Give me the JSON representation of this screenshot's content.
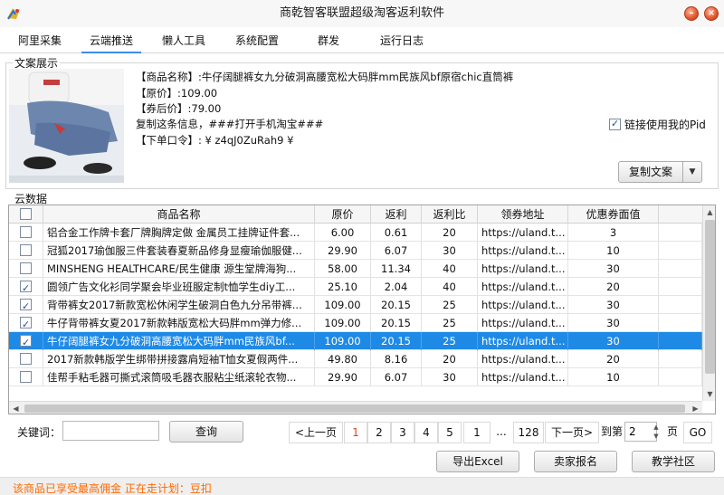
{
  "window": {
    "title": "商乾智客联盟超级淘客返利软件",
    "min_glyph": "–",
    "close_glyph": "×",
    "accent": "#1f8ae6",
    "logo_icon": "app-logo-icon"
  },
  "tabs": [
    {
      "label": "阿里采集"
    },
    {
      "label": "云端推送"
    },
    {
      "label": "懒人工具"
    },
    {
      "label": "系统配置"
    },
    {
      "label": "群发"
    },
    {
      "label": "运行日志"
    }
  ],
  "copy_panel": {
    "title": "文案展示",
    "lines": [
      "【商品名称】:牛仔阔腿裤女九分破洞高腰宽松大码胖mm民族风bf原宿chic直筒裤",
      "【原价】:109.00",
      "【券后价】:79.00",
      "复制这条信息，###打开手机淘宝###",
      "【下单口令】: ¥ z4qJ0ZuRah9 ¥"
    ],
    "use_my_pid_label": "链接使用我的Pid",
    "use_my_pid_checked": true,
    "copy_button": "复制文案",
    "dropdown_glyph": "▼"
  },
  "cloud_data": {
    "title": "云数据",
    "columns": [
      "商品名称",
      "原价",
      "返利",
      "返利比",
      "领券地址",
      "优惠券面值"
    ],
    "rows": [
      {
        "checked": false,
        "name": "铝合金工作牌卡套厂牌胸牌定做 金属员工挂牌证件套...",
        "price": "6.00",
        "rebate": "0.61",
        "ratio": "20",
        "url": "https://uland.t...",
        "coupon": "3",
        "selected": false
      },
      {
        "checked": false,
        "name": "冠狐2017瑜伽服三件套装春夏新品修身显瘦瑜伽服健...",
        "price": "29.90",
        "rebate": "6.07",
        "ratio": "30",
        "url": "https://uland.t...",
        "coupon": "10",
        "selected": false
      },
      {
        "checked": false,
        "name": "MINSHENG HEALTHCARE/民生健康 源生堂牌海狗...",
        "price": "58.00",
        "rebate": "11.34",
        "ratio": "40",
        "url": "https://uland.t...",
        "coupon": "30",
        "selected": false
      },
      {
        "checked": true,
        "name": " 圆领广告文化衫同学聚会毕业班服定制t恤学生diy工...",
        "price": "25.10",
        "rebate": "2.04",
        "ratio": "40",
        "url": "https://uland.t...",
        "coupon": "20",
        "selected": false
      },
      {
        "checked": true,
        "name": "背带裤女2017新款宽松休闲学生破洞白色九分吊带裤...",
        "price": "109.00",
        "rebate": "20.15",
        "ratio": "25",
        "url": "https://uland.t...",
        "coupon": "30",
        "selected": false
      },
      {
        "checked": true,
        "name": "牛仔背带裤女夏2017新款韩版宽松大码胖mm弹力修...",
        "price": "109.00",
        "rebate": "20.15",
        "ratio": "25",
        "url": "https://uland.t...",
        "coupon": "30",
        "selected": false
      },
      {
        "checked": true,
        "name": " 牛仔阔腿裤女九分破洞高腰宽松大码胖mm民族风bf...",
        "price": "109.00",
        "rebate": "20.15",
        "ratio": "25",
        "url": "https://uland.t...",
        "coupon": "30",
        "selected": true
      },
      {
        "checked": false,
        "name": "2017新款韩版学生绑带拼接露肩短袖T恤女夏假两件...",
        "price": "49.80",
        "rebate": "8.16",
        "ratio": "20",
        "url": "https://uland.t...",
        "coupon": "20",
        "selected": false
      },
      {
        "checked": false,
        "name": "佳帮手粘毛器可撕式滚筒吸毛器衣服粘尘纸滚轮衣物...",
        "price": "29.90",
        "rebate": "6.07",
        "ratio": "30",
        "url": "https://uland.t...",
        "coupon": "10",
        "selected": false
      }
    ]
  },
  "search": {
    "label": "关键词：",
    "value": "",
    "query_button": "查询"
  },
  "pagination": {
    "prev": "<上一页",
    "pages": [
      "1",
      "2",
      "3",
      "4",
      "5",
      "1",
      "..."
    ],
    "current_page": "1",
    "last": "128",
    "next": "下一页>",
    "goto_prefix": "到第",
    "goto_value": "2",
    "goto_suffix": "页",
    "go_button": "GO"
  },
  "actions": {
    "export": "导出Excel",
    "seller_signup": "卖家报名",
    "tutorial": "教学社区"
  },
  "status": {
    "text": "该商品已享受最高佣金 正在走计划：豆扣",
    "color": "#ff6a00"
  }
}
